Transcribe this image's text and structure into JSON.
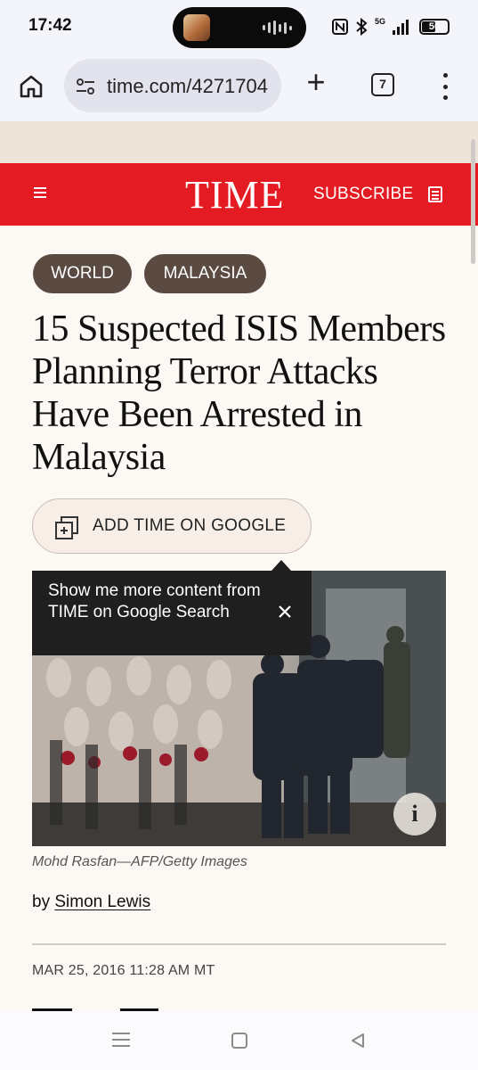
{
  "status_bar": {
    "time": "17:42",
    "network": "5G",
    "battery": "50"
  },
  "browser": {
    "url": "time.com/4271704",
    "tab_count": "7"
  },
  "masthead": {
    "logo": "TIME",
    "subscribe": "SUBSCRIBE"
  },
  "article": {
    "tags": [
      "WORLD",
      "MALAYSIA"
    ],
    "headline": "15 Suspected ISIS Members Planning Terror Attacks Have Been Arrested in Malaysia",
    "add_google": "ADD TIME ON GOOGLE",
    "tooltip": "Show me more content from TIME on Google Search",
    "caption": "Mohd Rasfan—AFP/Getty Images",
    "byline_prefix": "by",
    "author": "Simon Lewis",
    "date": "MAR 25, 2016 11:28 AM MT"
  },
  "icons": {
    "home": "home-icon",
    "site_settings": "tune-icon",
    "new_tab": "plus-icon",
    "more": "more-vert-icon",
    "menu": "hamburger-icon",
    "subscribe": "document-icon",
    "add_google": "add-to-collection-icon",
    "close": "close-icon",
    "info": "info-icon"
  },
  "colors": {
    "brand_red": "#e41b22",
    "tag_bg": "#5a4a42",
    "page_bg": "#fcf8f3",
    "tooltip_bg": "#1f1f1f"
  }
}
